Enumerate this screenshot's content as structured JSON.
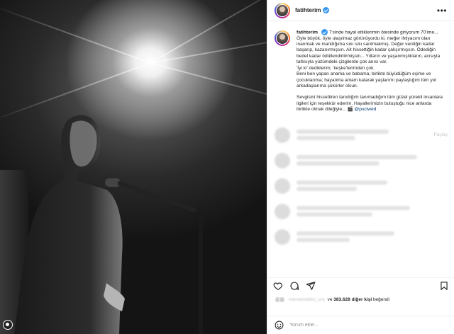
{
  "post": {
    "image_alt": "Black and white photo of a man at a microphone under a bright stage light"
  },
  "header": {
    "username": "fatihterim",
    "more_icon": "more-horizontal-icon"
  },
  "caption": {
    "username": "fatihterim",
    "lines": [
      "7'sinde hayal ettiklerimin ötesinde giriyorum 70'ime... Öyle büyük, öyle ulaşılmaz görünüyordu ki, meğer ihtiyacım olan inanmak ve inandığıma sıkı sıkı sarılmakmış. Değer verdiğin kadar başarıp, kazanırmışsın. Ait hissettiğin kadar çalışırmışsın. Ödediğin bedel kadar ödüllendirilirmişsin... Yılların ve yaşanmışlıkların, acısıyla tatlısıyla yüzümdeki çizgilerde çok anısı var.",
      "'İyi ki' dediklerim, 'keşke'lerimden çok.",
      "Beni ben yapan anama ve babama; birlikte büyüdüğüm eşime ve çocuklarıma; hayatıma anlam katarak yaşlarımı paylaştığım tüm yol arkadaşlarıma şükürler olsun."
    ],
    "final_text": "Sevgisini hissettiren tanıdığım tanımadığım tüm güzel yürekli insanlara ilgileri için teşekkür ederim. Hayallerimizin buluştuğu nice anlarda birlikte olmak dileğiyle... 🎬 ",
    "mention": "@puciwed"
  },
  "comment": {
    "reply_label": "Paylaş"
  },
  "actions": {
    "like_icon": "heart-icon",
    "comment_icon": "comment-icon",
    "share_icon": "send-icon",
    "save_icon": "bookmark-icon"
  },
  "likes": {
    "liked_by_name": "mervelunbbo_ura",
    "conjunction": "ve",
    "count_text": "383.628 diğer kişi",
    "suffix": "beğendi"
  },
  "time": "",
  "comment_box": {
    "placeholder": "Yorum ekle...",
    "post_label": ""
  },
  "colors": {
    "verified": "#3897f0",
    "link": "#00376b",
    "border": "#efefef",
    "muted": "#8e8e8e"
  }
}
